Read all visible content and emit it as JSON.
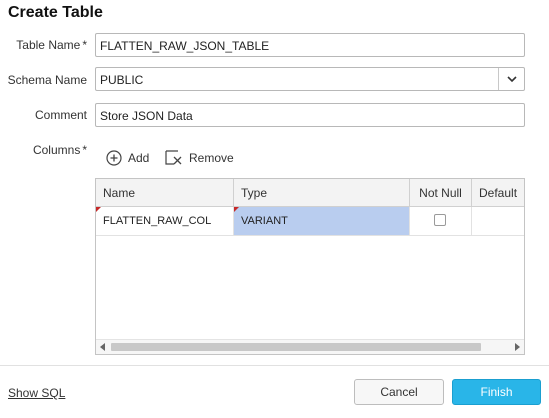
{
  "dialog": {
    "title": "Create Table"
  },
  "form": {
    "table_name": {
      "label": "Table Name",
      "required_mark": "*",
      "value": "FLATTEN_RAW_JSON_TABLE"
    },
    "schema_name": {
      "label": "Schema Name",
      "value": "PUBLIC"
    },
    "comment": {
      "label": "Comment",
      "value": "Store JSON Data"
    },
    "columns": {
      "label": "Columns",
      "required_mark": "*",
      "add_label": "Add",
      "remove_label": "Remove"
    }
  },
  "grid": {
    "headers": [
      "Name",
      "Type",
      "Not Null",
      "Default"
    ],
    "rows": [
      {
        "name": "FLATTEN_RAW_COL",
        "type": "VARIANT",
        "not_null": false,
        "default": ""
      }
    ]
  },
  "footer": {
    "show_sql": "Show SQL",
    "cancel": "Cancel",
    "finish": "Finish"
  },
  "colors": {
    "accent": "#29b5e8",
    "selected_cell": "#b9cdef",
    "flag": "#c62828"
  }
}
